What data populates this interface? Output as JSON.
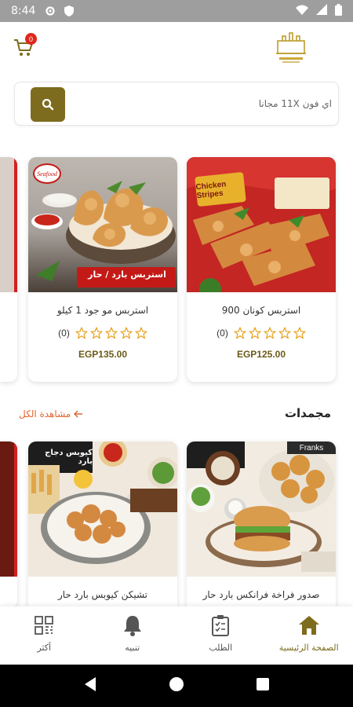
{
  "status_bar": {
    "time": "8:44"
  },
  "header": {
    "cart_count": "0"
  },
  "search": {
    "placeholder": "اي فون 11X مجانا"
  },
  "products_row1": [
    {
      "title": "استربس كونان 900",
      "rating_count": "(0)",
      "price": "EGP125.00",
      "image_label": "Chicken Stripes"
    },
    {
      "title": "استربس مو جود 1 كيلو",
      "rating_count": "(0)",
      "price": "EGP135.00",
      "image_label": "استربس بارد / حار"
    }
  ],
  "section": {
    "title": "مجمدات",
    "view_all": "مشاهدة الكل"
  },
  "products_row2": [
    {
      "title": "صدور فراخة فرانكس بارد حار",
      "image_label": "Franks"
    },
    {
      "title": "تشيكن كيوبس بارد حار",
      "image_label": "كيوبس دجاج بارد"
    }
  ],
  "bottom_nav": [
    {
      "label": "الصفحة الرئيسية",
      "icon": "home-icon",
      "active": true
    },
    {
      "label": "الطلب",
      "icon": "clipboard-icon"
    },
    {
      "label": "تنبيه",
      "icon": "bell-icon"
    },
    {
      "label": "أكثر",
      "icon": "grid-icon"
    }
  ],
  "colors": {
    "accent": "#7d6c1e",
    "price": "#6b5a17",
    "view_all": "#e06530",
    "badge": "#e0271b"
  }
}
